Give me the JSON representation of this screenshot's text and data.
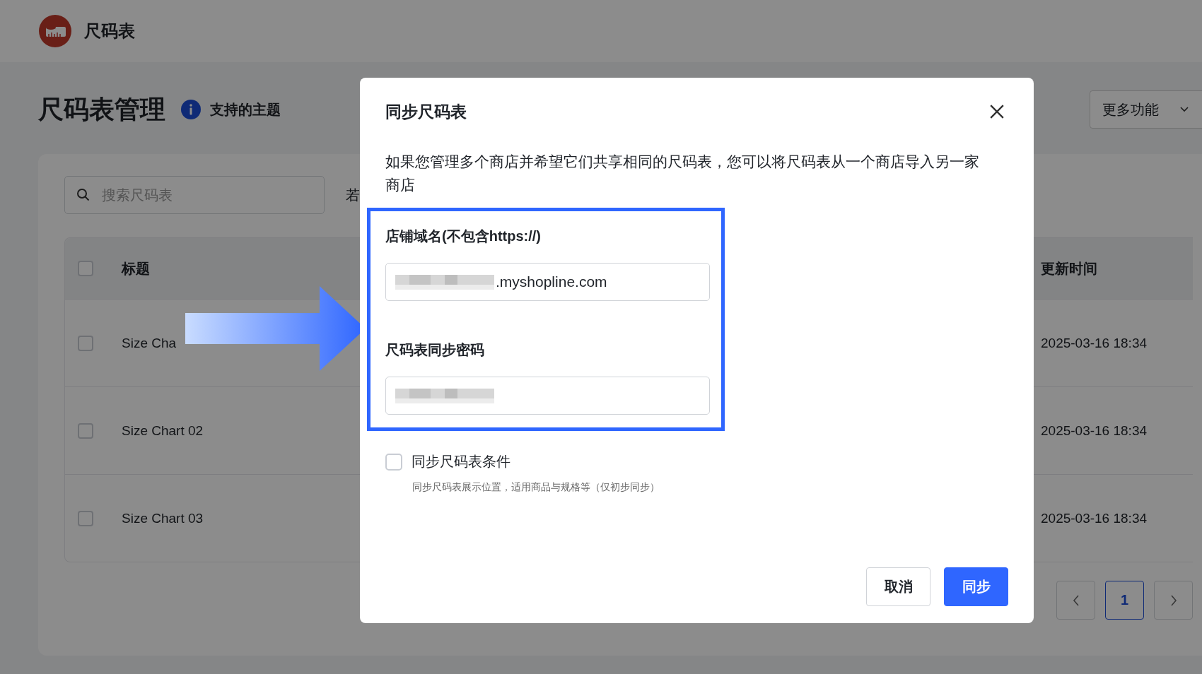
{
  "app": {
    "title": "尺码表"
  },
  "page": {
    "title": "尺码表管理",
    "info_link": "支持的主题",
    "more_button": "更多功能"
  },
  "search": {
    "placeholder": "搜索尺码表"
  },
  "filter_label": "若",
  "table": {
    "header_checked": false,
    "columns": [
      "标题",
      "更新时间"
    ],
    "rows": [
      {
        "title": "Size Cha",
        "updated": "2025-03-16 18:34",
        "checked": false
      },
      {
        "title": "Size Chart 02",
        "updated": "2025-03-16 18:34",
        "checked": false
      },
      {
        "title": "Size Chart 03",
        "updated": "2025-03-16 18:34",
        "checked": false
      }
    ]
  },
  "pagination": {
    "pages": [
      {
        "label": "1",
        "selected": true
      }
    ]
  },
  "dialog": {
    "title": "同步尺码表",
    "description": "如果您管理多个商店并希望它们共享相同的尺码表，您可以将尺码表从一个商店导入另一家商店",
    "fields": [
      {
        "label": "店铺域名(不包含https://)",
        "value": ".myshopline.com",
        "redacted": true
      },
      {
        "label": "尺码表同步密码",
        "redacted": true
      }
    ],
    "option": {
      "label": "同步尺码表条件",
      "hint": "同步尺码表展示位置，适用商品与规格等（仅初步同步）",
      "checked": false
    },
    "buttons": [
      {
        "label": "取消",
        "kind": "secondary"
      },
      {
        "label": "同步",
        "kind": "primary"
      }
    ]
  }
}
